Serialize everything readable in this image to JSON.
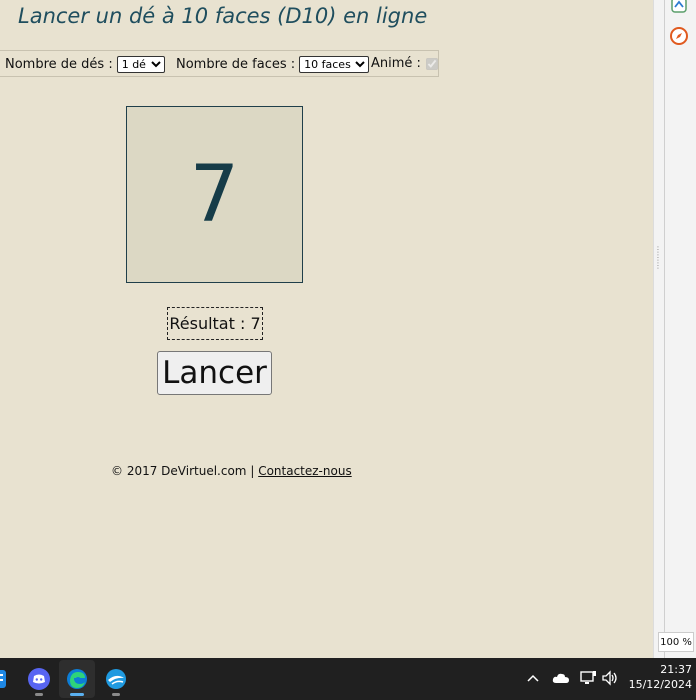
{
  "page": {
    "title": "Lancer un dé à 10 faces (D10) en ligne",
    "options": {
      "dice_count_label": "Nombre de dés :",
      "dice_count_value": "1 dé",
      "faces_label": "Nombre de faces :",
      "faces_value": "10 faces",
      "animated_label": "Animé :"
    },
    "die_value": "7",
    "result_text": "Résultat : 7",
    "roll_button": "Lancer",
    "footer": {
      "copyright": "© 2017 DeVirtuel.com",
      "separator": "|",
      "contact_link": "Contactez-nous"
    }
  },
  "browser": {
    "zoom": "100 %"
  },
  "taskbar": {
    "time": "21:37",
    "date": "15/12/2024"
  },
  "colors": {
    "background": "#e8e2d0",
    "title": "#1f4e5e",
    "die_face": "#dcd8c4",
    "die_number": "#163c48"
  }
}
